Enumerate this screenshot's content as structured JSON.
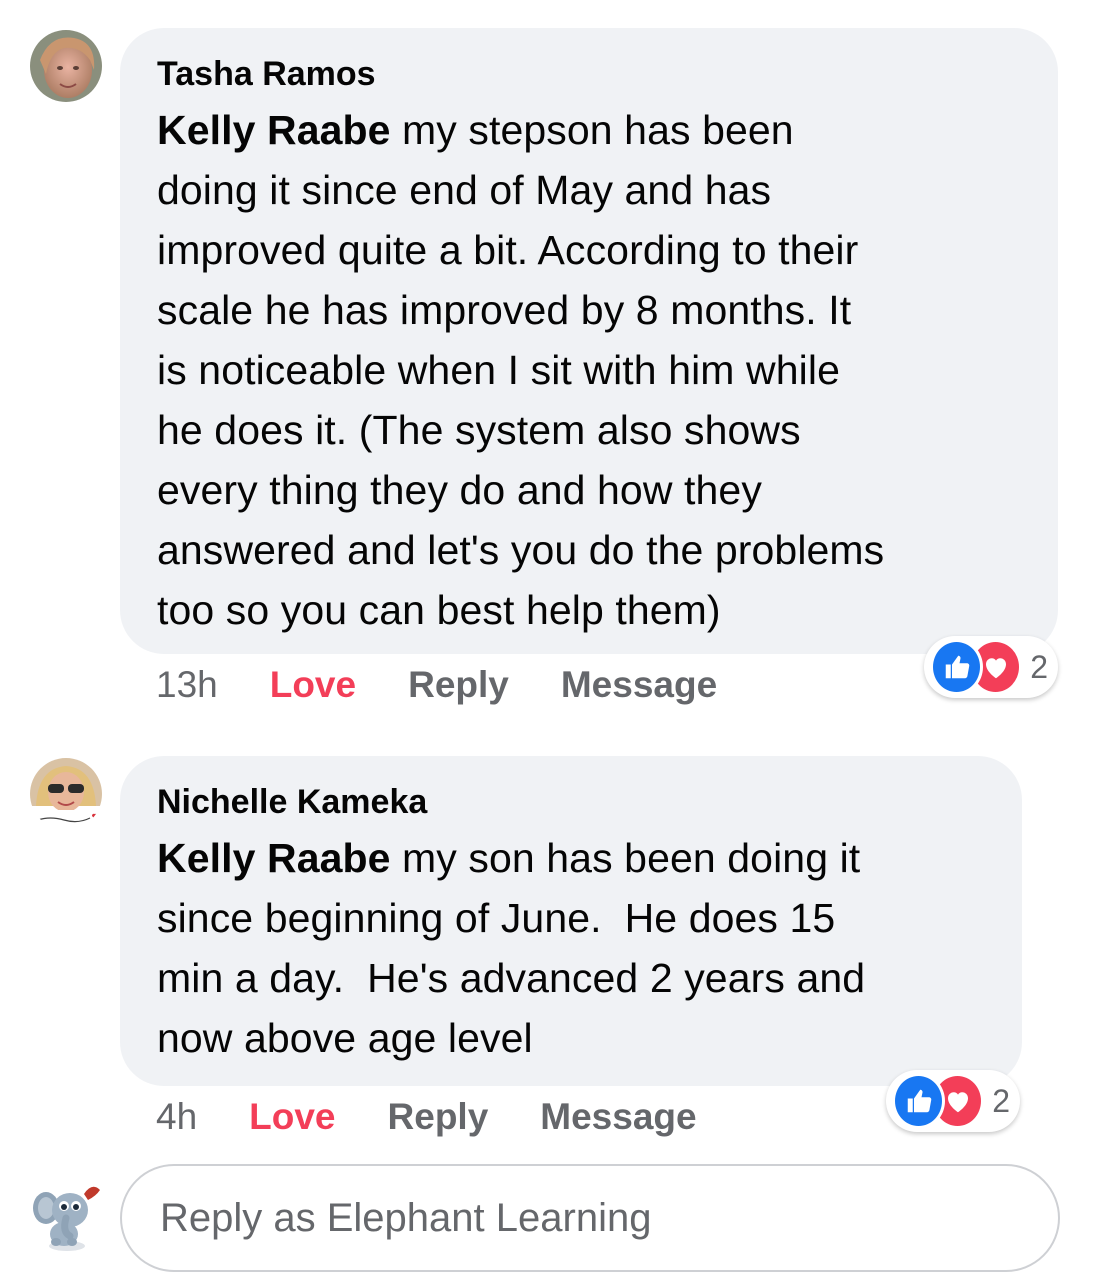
{
  "comments": [
    {
      "author": "Tasha Ramos",
      "mention": "Kelly Raabe",
      "text_lines": [
        " my stepson has been",
        "doing it since end of May and has",
        "improved quite a bit. According to their",
        "scale he has improved by 8 months. It",
        "is noticeable when I sit with him while",
        "he does it. (The system also shows",
        "every thing they do and how they",
        "answered and let's you do the problems",
        "too so you can best help them)"
      ],
      "time": "13h",
      "love_label": "Love",
      "reply_label": "Reply",
      "message_label": "Message",
      "reaction_count": "2"
    },
    {
      "author": "Nichelle Kameka",
      "mention": "Kelly Raabe",
      "text_lines": [
        " my son has been doing it",
        "since beginning of June.  He does 15",
        "min a day.  He's advanced 2 years and",
        "now above age level"
      ],
      "time": "4h",
      "love_label": "Love",
      "reply_label": "Reply",
      "message_label": "Message",
      "reaction_count": "2"
    }
  ],
  "reply_box": {
    "placeholder": "Reply as Elephant Learning"
  },
  "colors": {
    "bubble_bg": "#f0f2f5",
    "love_red": "#f33e58",
    "like_blue": "#1877f2",
    "muted_gray": "#65676b"
  },
  "icons": {
    "like": "thumbs-up-icon",
    "love": "heart-icon"
  }
}
